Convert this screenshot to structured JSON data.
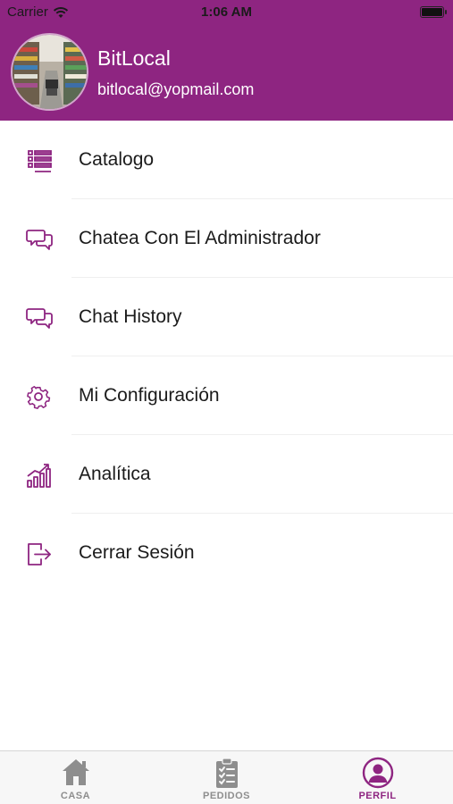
{
  "status_bar": {
    "carrier": "Carrier",
    "time": "1:06 AM"
  },
  "profile": {
    "name": "BitLocal",
    "email": "bitlocal@yopmail.com"
  },
  "menu": {
    "items": [
      {
        "label": "Catalogo",
        "icon": "list-icon"
      },
      {
        "label": "Chatea Con El Administrador",
        "icon": "chat-bubbles-icon"
      },
      {
        "label": "Chat History",
        "icon": "chat-bubbles-icon"
      },
      {
        "label": "Mi Configuración",
        "icon": "gear-icon"
      },
      {
        "label": "Analítica",
        "icon": "analytics-chart-icon"
      },
      {
        "label": "Cerrar Sesión",
        "icon": "logout-icon"
      }
    ]
  },
  "tabbar": {
    "tabs": [
      {
        "label": "CASA",
        "icon": "home-icon",
        "active": false
      },
      {
        "label": "PEDIDOS",
        "icon": "clipboard-icon",
        "active": false
      },
      {
        "label": "PERFIL",
        "icon": "profile-icon",
        "active": true
      }
    ]
  },
  "colors": {
    "brand": "#8e2581",
    "inactive_tab": "#8e8e8e",
    "text": "#1b1b1b"
  }
}
